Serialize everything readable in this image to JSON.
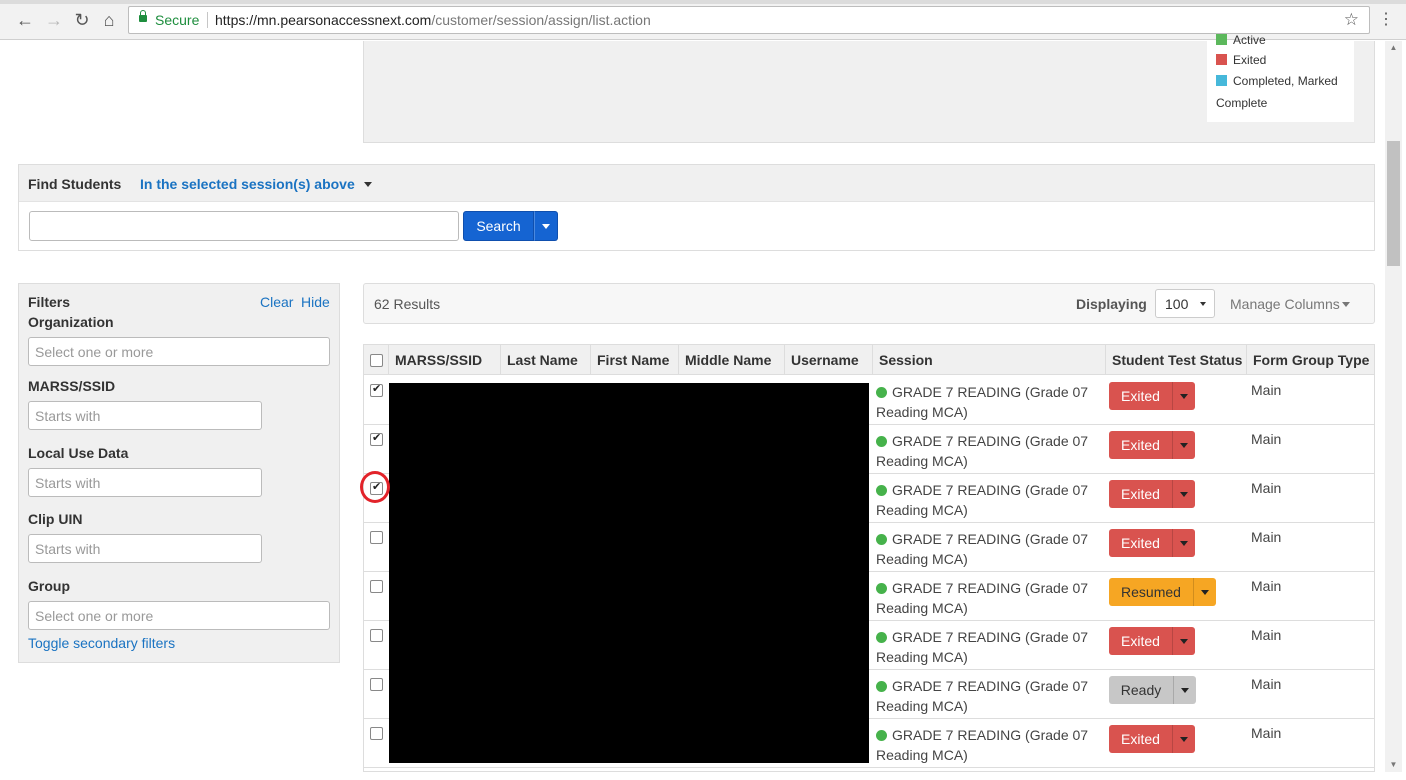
{
  "browser": {
    "secure_label": "Secure",
    "url_host": "https://mn.pearsonaccessnext.com",
    "url_path": "/customer/session/assign/list.action"
  },
  "legend": {
    "items": [
      {
        "label": "Active",
        "color": "#5cb85c"
      },
      {
        "label": "Exited",
        "color": "#d9534f"
      },
      {
        "label": "Completed, Marked",
        "color": "#46b8da"
      }
    ],
    "continuation": "Complete"
  },
  "find": {
    "title": "Find Students",
    "scope": "In the selected session(s) above",
    "search_label": "Search",
    "search_value": ""
  },
  "filters": {
    "title": "Filters",
    "clear": "Clear",
    "hide": "Hide",
    "organization_label": "Organization",
    "organization_placeholder": "Select one or more",
    "marss_label": "MARSS/SSID",
    "marss_placeholder": "Starts with",
    "local_label": "Local Use Data",
    "local_placeholder": "Starts with",
    "clip_label": "Clip UIN",
    "clip_placeholder": "Starts with",
    "group_label": "Group",
    "group_placeholder": "Select one or more",
    "toggle": "Toggle secondary filters"
  },
  "results": {
    "count": "62 Results",
    "displaying": "Displaying",
    "page_size": "100",
    "manage_columns": "Manage Columns"
  },
  "table": {
    "headers": {
      "marss": "MARSS/SSID",
      "last": "Last Name",
      "first": "First Name",
      "middle": "Middle Name",
      "username": "Username",
      "session": "Session",
      "status": "Student Test Status",
      "form": "Form Group Type"
    },
    "rows": [
      {
        "checked": true,
        "session_a": "GRADE 7 READING (Grade 07",
        "session_b": "Reading MCA)",
        "status": "Exited",
        "form": "Main"
      },
      {
        "checked": true,
        "session_a": "GRADE 7 READING (Grade 07",
        "session_b": "Reading MCA)",
        "status": "Exited",
        "form": "Main"
      },
      {
        "checked": true,
        "session_a": "GRADE 7 READING (Grade 07",
        "session_b": "Reading MCA)",
        "status": "Exited",
        "form": "Main"
      },
      {
        "checked": false,
        "session_a": "GRADE 7 READING (Grade 07",
        "session_b": "Reading MCA)",
        "status": "Exited",
        "form": "Main"
      },
      {
        "checked": false,
        "session_a": "GRADE 7 READING (Grade 07",
        "session_b": "Reading MCA)",
        "status": "Resumed",
        "form": "Main"
      },
      {
        "checked": false,
        "session_a": "GRADE 7 READING (Grade 07",
        "session_b": "Reading MCA)",
        "status": "Exited",
        "form": "Main"
      },
      {
        "checked": false,
        "session_a": "GRADE 7 READING (Grade 07",
        "session_b": "Reading MCA)",
        "status": "Ready",
        "form": "Main"
      },
      {
        "checked": false,
        "session_a": "GRADE 7 READING (Grade 07",
        "session_b": "Reading MCA)",
        "status": "Exited",
        "form": "Main"
      }
    ],
    "status_colors": {
      "Exited": "#d9534f",
      "Resumed": "#f6a623",
      "Ready": "#c7c7c7"
    }
  }
}
